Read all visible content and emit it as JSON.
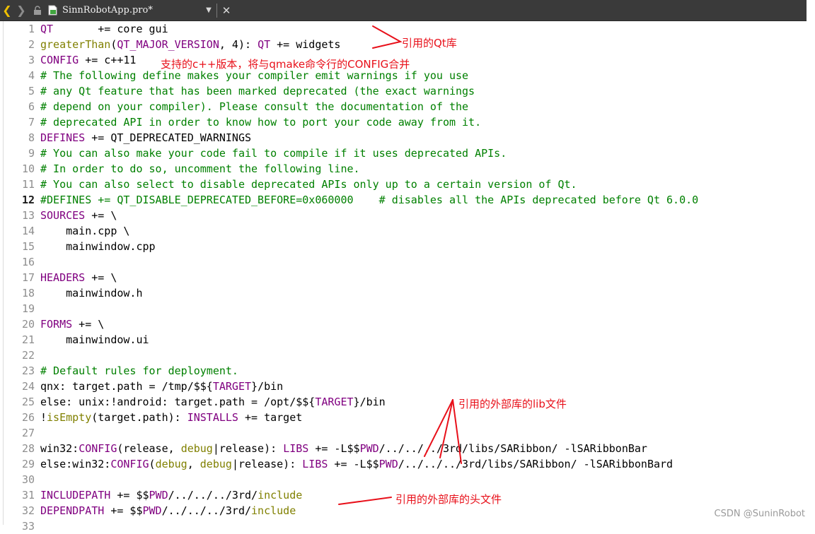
{
  "tab": {
    "title": "SinnRobotApp.pro*",
    "back_glyph": "❮",
    "forward_glyph": "❯",
    "dropdown_glyph": "▼",
    "close_glyph": "✕"
  },
  "lines": [
    {
      "n": "1",
      "code": "QT       += core gui"
    },
    {
      "n": "2",
      "code": "greaterThan(QT_MAJOR_VERSION, 4): QT += widgets"
    },
    {
      "n": "3",
      "code": "CONFIG += c++11"
    },
    {
      "n": "4",
      "code": "# The following define makes your compiler emit warnings if you use"
    },
    {
      "n": "5",
      "code": "# any Qt feature that has been marked deprecated (the exact warnings"
    },
    {
      "n": "6",
      "code": "# depend on your compiler). Please consult the documentation of the"
    },
    {
      "n": "7",
      "code": "# deprecated API in order to know how to port your code away from it."
    },
    {
      "n": "8",
      "code": "DEFINES += QT_DEPRECATED_WARNINGS"
    },
    {
      "n": "9",
      "code": "# You can also make your code fail to compile if it uses deprecated APIs."
    },
    {
      "n": "10",
      "code": "# In order to do so, uncomment the following line."
    },
    {
      "n": "11",
      "code": "# You can also select to disable deprecated APIs only up to a certain version of Qt."
    },
    {
      "n": "12",
      "code": "#DEFINES += QT_DISABLE_DEPRECATED_BEFORE=0x060000    # disables all the APIs deprecated before Qt 6.0.0"
    },
    {
      "n": "13",
      "code": "SOURCES += \\"
    },
    {
      "n": "14",
      "code": "    main.cpp \\"
    },
    {
      "n": "15",
      "code": "    mainwindow.cpp"
    },
    {
      "n": "16",
      "code": ""
    },
    {
      "n": "17",
      "code": "HEADERS += \\"
    },
    {
      "n": "18",
      "code": "    mainwindow.h"
    },
    {
      "n": "19",
      "code": ""
    },
    {
      "n": "20",
      "code": "FORMS += \\"
    },
    {
      "n": "21",
      "code": "    mainwindow.ui"
    },
    {
      "n": "22",
      "code": ""
    },
    {
      "n": "23",
      "code": "# Default rules for deployment."
    },
    {
      "n": "24",
      "code": "qnx: target.path = /tmp/$${TARGET}/bin"
    },
    {
      "n": "25",
      "code": "else: unix:!android: target.path = /opt/$${TARGET}/bin"
    },
    {
      "n": "26",
      "code": "!isEmpty(target.path): INSTALLS += target"
    },
    {
      "n": "27",
      "code": ""
    },
    {
      "n": "28",
      "code": "win32:CONFIG(release, debug|release): LIBS += -L$$PWD/../../../3rd/libs/SARibbon/ -lSARibbonBar"
    },
    {
      "n": "29",
      "code": "else:win32:CONFIG(debug, debug|release): LIBS += -L$$PWD/../../../3rd/libs/SARibbon/ -lSARibbonBard"
    },
    {
      "n": "30",
      "code": ""
    },
    {
      "n": "31",
      "code": "INCLUDEPATH += $$PWD/../../../3rd/include"
    },
    {
      "n": "32",
      "code": "DEPENDPATH += $$PWD/../../../3rd/include"
    },
    {
      "n": "33",
      "code": ""
    }
  ],
  "annotations": {
    "qt_lib": "引用的Qt库",
    "cpp_version": "支持的c++版本，将与qmake命令行的CONFIG合并",
    "lib_files": "引用的外部库的lib文件",
    "header_files": "引用的外部库的头文件"
  },
  "watermark": "CSDN @SuninRobot",
  "colors": {
    "annotation": "#e8101a",
    "keyword": "#800080",
    "comment": "#008000",
    "function": "#808000",
    "tabbar": "#3a3a3a"
  }
}
